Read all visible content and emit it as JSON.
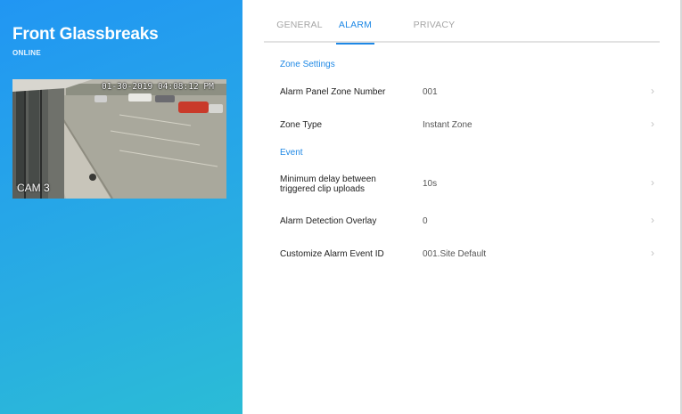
{
  "device": {
    "name": "Front Glassbreaks",
    "status": "ONLINE"
  },
  "camera": {
    "timestamp": "01-30-2019 04:08:12 PM",
    "label": "CAM 3"
  },
  "tabs": [
    {
      "label": "GENERAL",
      "active": false
    },
    {
      "label": "ALARM",
      "active": true
    },
    {
      "label": "PRIVACY",
      "active": false
    }
  ],
  "sections": {
    "zone_settings": "Zone Settings",
    "event": "Event"
  },
  "rows": [
    {
      "label": "Alarm Panel Zone Number",
      "value": "001"
    },
    {
      "label": "Zone Type",
      "value": "Instant Zone"
    },
    {
      "label": "Minimum delay between",
      "label2": "triggered clip uploads",
      "value": "10s"
    },
    {
      "label": "Alarm Detection Overlay",
      "value": "0"
    },
    {
      "label": "Customize Alarm Event ID",
      "value": "001.Site Default"
    }
  ],
  "colors": {
    "accent": "#1e88e5",
    "panel_gradient_start": "#2196f3",
    "panel_gradient_end": "#2bbcd6"
  },
  "icons": {
    "row_arrow": "chevron-right-icon"
  }
}
